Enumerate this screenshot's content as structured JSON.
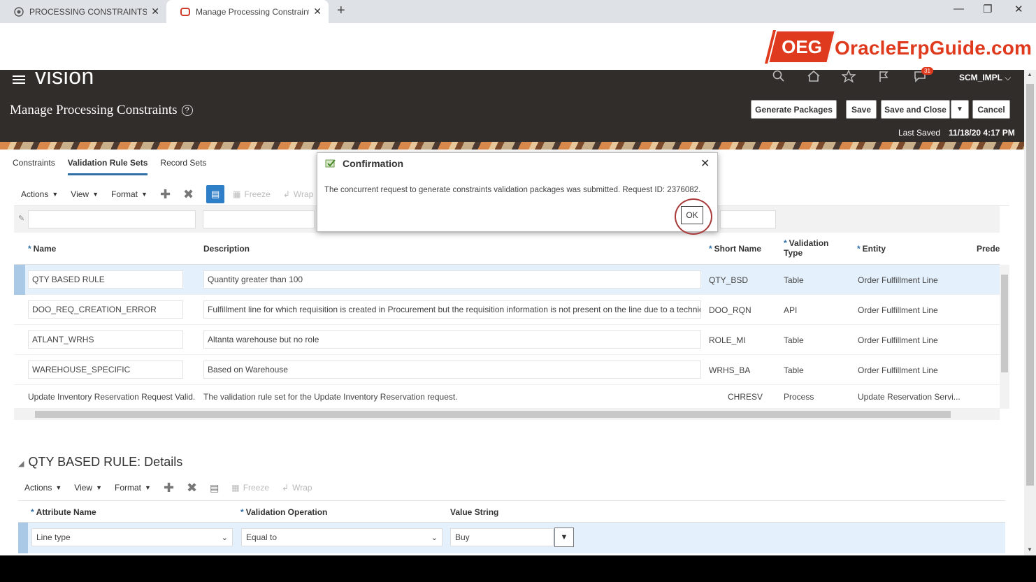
{
  "browser": {
    "tabs": [
      {
        "title": "PROCESSING CONSTRAINTS.pdf",
        "close": "✕"
      },
      {
        "title": "Manage Processing Constraints -",
        "close": "✕"
      }
    ],
    "newtab": "+",
    "window_controls": {
      "minimize": "—",
      "restore": "❐",
      "close": "✕"
    }
  },
  "brand": {
    "logo_mark": "OEG",
    "logo_text": "OracleErpGuide.com",
    "color": "#e03a1e"
  },
  "header": {
    "app_name": "vision",
    "notification_count": "31",
    "user": "SCM_IMPL",
    "page_title": "Manage Processing Constraints",
    "help": "?",
    "buttons": {
      "generate": "Generate Packages",
      "save": "Save",
      "save_close": "Save and Close",
      "cancel": "Cancel"
    },
    "last_saved_label": "Last Saved",
    "last_saved_value": "11/18/20 4:17 PM"
  },
  "subtabs": [
    "Constraints",
    "Validation Rule Sets",
    "Record Sets"
  ],
  "toolbar": {
    "actions": "Actions",
    "view": "View",
    "format": "Format",
    "freeze": "Freeze",
    "wrap": "Wrap"
  },
  "table": {
    "columns": {
      "name": "Name",
      "description": "Description",
      "short_name": "Short Name",
      "validation_type": "Validation Type",
      "entity": "Entity",
      "prede": "Prede"
    },
    "rows": [
      {
        "name": "QTY BASED RULE",
        "description": "Quantity greater than 100",
        "short_name": "QTY_BSD",
        "type": "Table",
        "entity": "Order Fulfillment Line"
      },
      {
        "name": "DOO_REQ_CREATION_ERROR",
        "description": "Fulfillment line for which requisition is created in Procurement but the requisition information is not present on the line due to a technical f",
        "short_name": "DOO_RQN",
        "type": "API",
        "entity": "Order Fulfillment Line"
      },
      {
        "name": "ATLANT_WRHS",
        "description": "Altanta warehouse but no role",
        "short_name": "ROLE_MI",
        "type": "Table",
        "entity": "Order Fulfillment Line"
      },
      {
        "name": "WAREHOUSE_SPECIFIC",
        "description": "Based on Warehouse",
        "short_name": "WRHS_BA",
        "type": "Table",
        "entity": "Order Fulfillment Line"
      },
      {
        "name": "Update Inventory Reservation Request Valid...",
        "description": "The validation rule set for the Update Inventory Reservation request.",
        "short_name": "CHRESV",
        "type": "Process",
        "entity": "Update Reservation Servi..."
      }
    ]
  },
  "details": {
    "title": "QTY BASED RULE: Details",
    "columns": {
      "attribute": "Attribute Name",
      "operation": "Validation Operation",
      "value": "Value String"
    },
    "row": {
      "attribute": "Line type",
      "operation": "Equal to",
      "value": "Buy"
    }
  },
  "dialog": {
    "title": "Confirmation",
    "close": "✕",
    "message": "The concurrent request to generate constraints validation packages was submitted. Request ID: 2376082.",
    "ok": "OK"
  }
}
